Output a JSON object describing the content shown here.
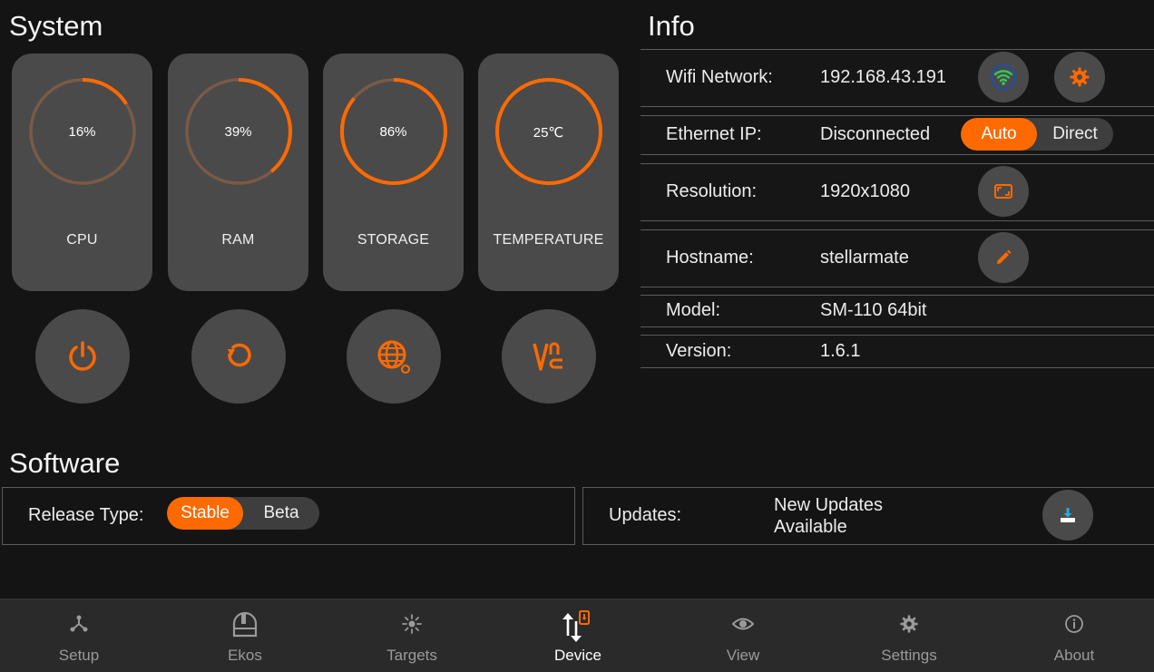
{
  "system": {
    "title": "System",
    "gauges": [
      {
        "label": "CPU",
        "value_text": "16%",
        "fraction": 0.16
      },
      {
        "label": "RAM",
        "value_text": "39%",
        "fraction": 0.39
      },
      {
        "label": "STORAGE",
        "value_text": "86%",
        "fraction": 0.86
      },
      {
        "label": "TEMPERATURE",
        "value_text": "25℃",
        "fraction": 1.0
      }
    ],
    "buttons": [
      "power-icon",
      "restart-icon",
      "globe-icon",
      "vnc-icon"
    ]
  },
  "info": {
    "title": "Info",
    "wifi": {
      "label": "Wifi Network:",
      "value": "192.168.43.191"
    },
    "ethernet": {
      "label": "Ethernet IP:",
      "value": "Disconnected",
      "options": [
        "Auto",
        "Direct"
      ],
      "selected": "Auto"
    },
    "resolution": {
      "label": "Resolution:",
      "value": "1920x1080"
    },
    "hostname": {
      "label": "Hostname:",
      "value": "stellarmate"
    },
    "model": {
      "label": "Model:",
      "value": "SM-110 64bit"
    },
    "version": {
      "label": "Version:",
      "value": "1.6.1"
    }
  },
  "software": {
    "title": "Software",
    "release": {
      "label": "Release Type:",
      "options": [
        "Stable",
        "Beta"
      ],
      "selected": "Stable"
    },
    "updates": {
      "label": "Updates:",
      "status_line1": "New Updates",
      "status_line2": "Available"
    }
  },
  "nav": {
    "items": [
      "Setup",
      "Ekos",
      "Targets",
      "Device",
      "View",
      "Settings",
      "About"
    ],
    "active": "Device"
  },
  "colors": {
    "accent": "#ff6a00",
    "gauge_track": "#7a5a46",
    "card": "#4a4a4a",
    "wifi_green": "#34c759",
    "wifi_ring": "#1e4fa8"
  }
}
